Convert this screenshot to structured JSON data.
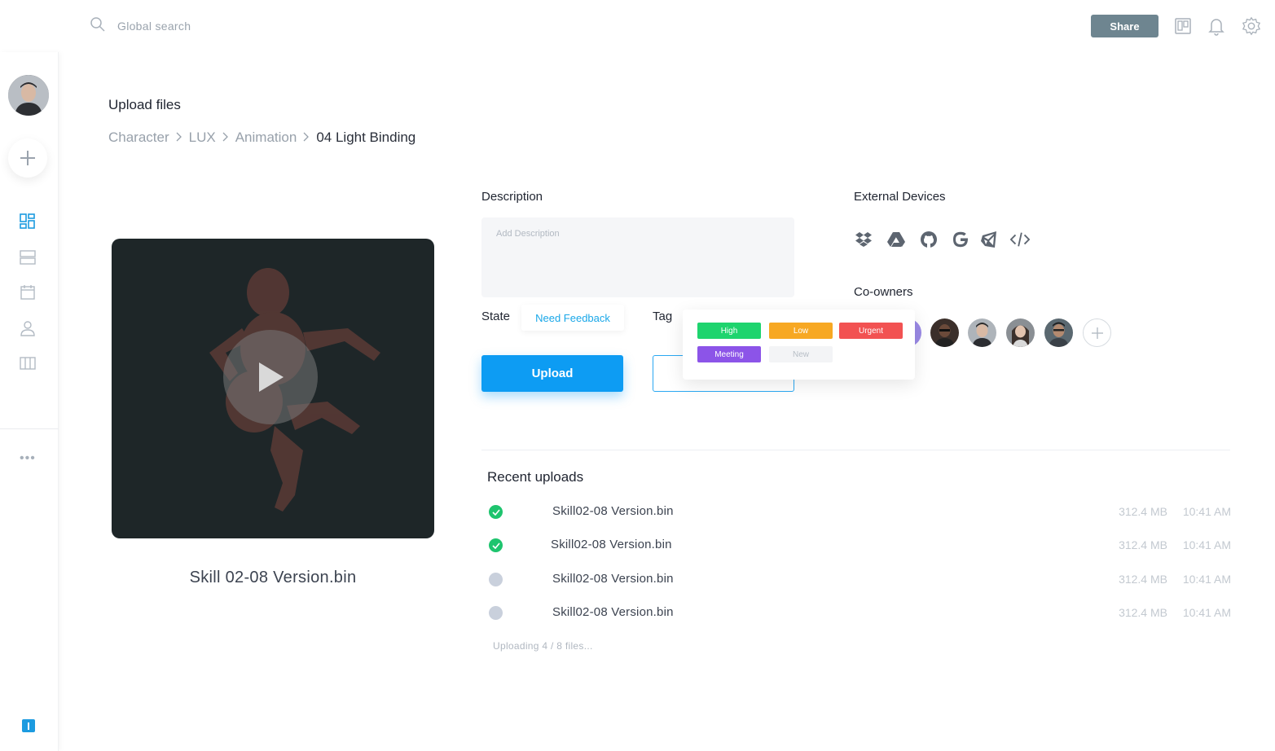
{
  "topbar": {
    "search_placeholder": "Global search",
    "share_label": "Share",
    "icons": [
      "search-icon",
      "board-icon",
      "bell-icon",
      "gear-icon"
    ]
  },
  "sidebar": {
    "icons": [
      "dashboard-icon",
      "list-icon",
      "calendar-icon",
      "user-icon",
      "columns-icon"
    ],
    "more": "•••",
    "accent": "#1c9be0"
  },
  "header": {
    "title": "Upload files",
    "breadcrumb": [
      "Character",
      "LUX",
      "Animation",
      "04 Light Binding"
    ]
  },
  "video": {
    "caption": "Skill 02-08 Version.bin"
  },
  "form": {
    "description_label": "Description",
    "description_placeholder": "Add Description",
    "state_label": "State",
    "state_value": "Need Feedback",
    "tag_label": "Tag",
    "upload_label": "Upload"
  },
  "tags": [
    {
      "label": "High",
      "color": "#1ed46e"
    },
    {
      "label": "Low",
      "color": "#f7a823"
    },
    {
      "label": "Urgent",
      "color": "#f25252"
    },
    {
      "label": "Meeting",
      "color": "#8c54e8"
    },
    {
      "label": "New",
      "color": "#f3f4f6"
    }
  ],
  "external": {
    "title": "External Devices",
    "icons": [
      "dropbox-icon",
      "google-drive-icon",
      "github-icon",
      "google-icon",
      "unity-icon",
      "code-icon"
    ]
  },
  "coowners": {
    "title": "Co-owners",
    "add": "+"
  },
  "recent": {
    "title": "Recent uploads",
    "items": [
      {
        "name": "Skill02-08 Version.bin",
        "size": "312.4 MB",
        "time": "10:41 AM",
        "done": true
      },
      {
        "name": "Skill02-08 Version.bin",
        "size": "312.4 MB",
        "time": "10:41 AM",
        "done": true
      },
      {
        "name": "Skill02-08 Version.bin",
        "size": "312.4 MB",
        "time": "10:41 AM",
        "done": false
      },
      {
        "name": "Skill02-08 Version.bin",
        "size": "312.4 MB",
        "time": "10:41 AM",
        "done": false
      }
    ],
    "progress": "Uploading 4 / 8 files..."
  },
  "colors": {
    "primary": "#0d9cf3",
    "success": "#1ec46e",
    "pending": "#c9d0dc"
  }
}
